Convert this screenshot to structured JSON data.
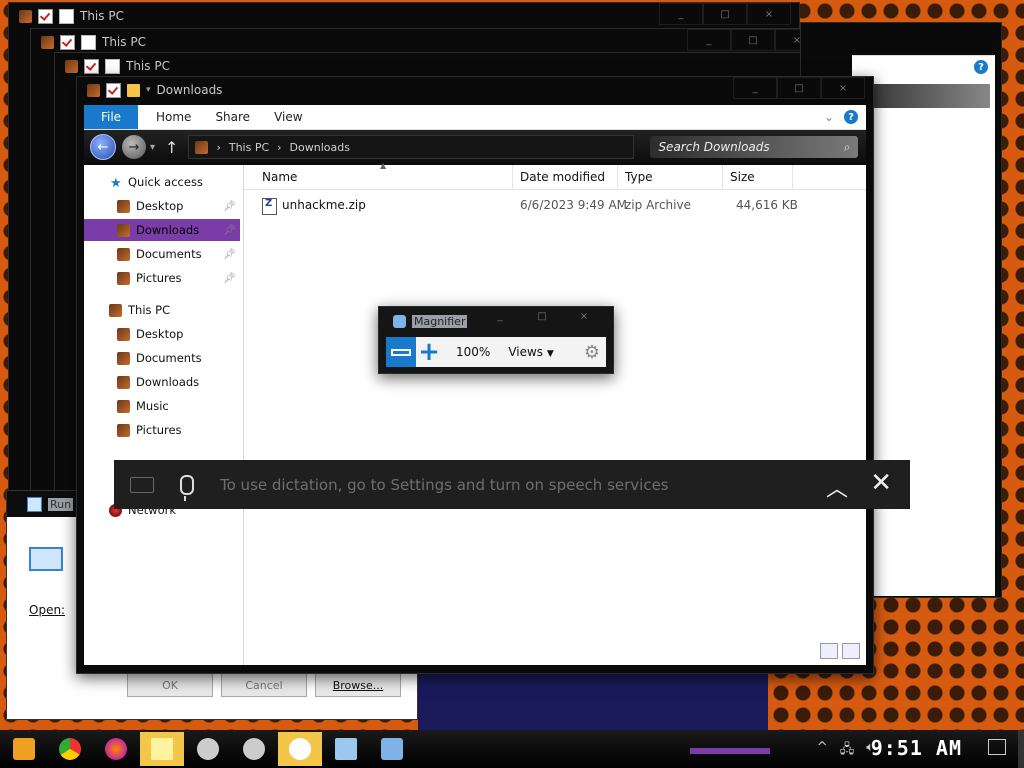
{
  "back_windows": [
    {
      "title": "This PC"
    },
    {
      "title": "This PC"
    },
    {
      "title": "This PC"
    }
  ],
  "explorer": {
    "title": "Downloads",
    "ribbon": {
      "file": "File",
      "tabs": [
        "Home",
        "Share",
        "View"
      ]
    },
    "address": {
      "crumbs": [
        "This PC",
        "Downloads"
      ]
    },
    "search_placeholder": "Search Downloads",
    "nav": {
      "quick_access": "Quick access",
      "quick_items": [
        "Desktop",
        "Downloads",
        "Documents",
        "Pictures"
      ],
      "this_pc": "This PC",
      "pc_items": [
        "Desktop",
        "Documents",
        "Downloads",
        "Music",
        "Pictures"
      ],
      "network": "Network"
    },
    "columns": [
      "Name",
      "Date modified",
      "Type",
      "Size"
    ],
    "files": [
      {
        "name": "unhackme.zip",
        "date": "6/6/2023 9:49 AM",
        "type": "zip Archive",
        "size": "44,616 KB"
      }
    ]
  },
  "magnifier": {
    "title": "Magnifier",
    "zoom": "100%",
    "views": "Views"
  },
  "dictation": {
    "text": "To use dictation, go to Settings and turn on speech services"
  },
  "run_dialog": {
    "title": "Run",
    "open_label": "Open:",
    "ok": "OK",
    "cancel": "Cancel",
    "browse": "Browse..."
  },
  "taskbar": {
    "icons": [
      "start-icon",
      "chrome-icon",
      "firefox-icon",
      "file-explorer-icon",
      "theme-icon",
      "theme-icon",
      "settings-icon",
      "run-icon",
      "magnifier-icon"
    ],
    "clock": "9:51 AM"
  },
  "colors": {
    "accent": "#1979ca",
    "selection": "#7a3da8",
    "wallpaper": "#d65a10"
  }
}
